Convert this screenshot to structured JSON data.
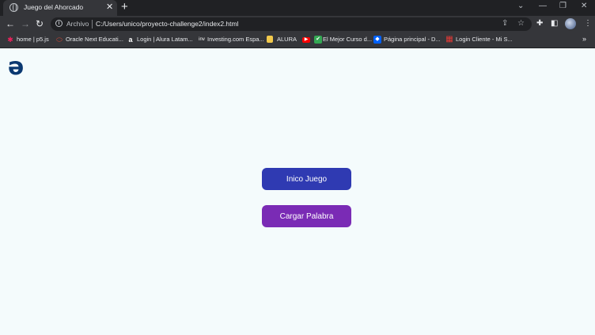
{
  "browser": {
    "tab_title": "Juego del Ahorcado",
    "tab_close": "✕",
    "new_tab": "+",
    "scheme_label": "Archivo",
    "url": "C:/Users/unico/proyecto-challenge2/index2.html"
  },
  "bookmarks": [
    {
      "label": "home | p5.js",
      "icon": "p5-icon",
      "color": "#ed225d",
      "glyph": "✱"
    },
    {
      "label": "Oracle Next Educati...",
      "icon": "oracle-icon",
      "color": "#c74634",
      "glyph": "⬭"
    },
    {
      "label": "Login | Alura Latam...",
      "icon": "alura-icon",
      "color": "#e8eaed",
      "glyph": "a"
    },
    {
      "label": "Investing.com Espa...",
      "icon": "investing-icon",
      "color": "#e8eaed",
      "glyph": "inv"
    },
    {
      "label": "ALURA",
      "icon": "folder-icon",
      "color": "#f2c94c",
      "glyph": "▮"
    },
    {
      "label": "",
      "icon": "youtube-icon",
      "color": "#ff0000",
      "glyph": "▶"
    },
    {
      "label": "El Mejor Curso d...",
      "icon": "course-icon",
      "color": "#34a853",
      "glyph": "✔"
    },
    {
      "label": "Página principal - D...",
      "icon": "dropbox-icon",
      "color": "#0061fe",
      "glyph": "◆"
    },
    {
      "label": "Login Cliente - Mi S...",
      "icon": "client-icon",
      "color": "#e53935",
      "glyph": "▦"
    }
  ],
  "page": {
    "logo_glyph": "ə",
    "start_button": "Inico Juego",
    "load_button": "Cargar Palabra"
  },
  "colors": {
    "page_background": "#f4fbfc",
    "logo": "#0a3871",
    "start_button": "#2f3ab2",
    "load_button": "#7a2bb5"
  }
}
